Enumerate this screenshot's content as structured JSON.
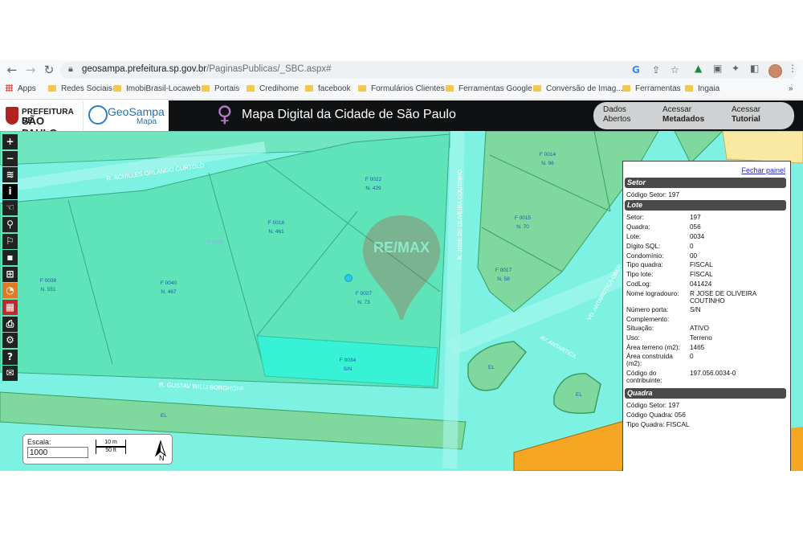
{
  "browser": {
    "url_host": "geosampa.prefeitura.sp.gov.br",
    "url_path": "/PaginasPublicas/_SBC.aspx#",
    "bookmarks": [
      "Apps",
      "Redes Sociais",
      "ImobiBrasil-Locaweb",
      "Portais",
      "Credihome",
      "facebook",
      "Formulários Clientes",
      "Ferramentas Google",
      "Conversão de Imag...",
      "Ferramentas",
      "Ingaia"
    ]
  },
  "header": {
    "pm_line1": "PREFEITURA DE",
    "pm_line2": "SÃO PAULO",
    "gs_title": "GeoSampa",
    "gs_sub": "Mapa",
    "app_title": "Mapa Digital da Cidade de São Paulo",
    "btn1_line1": "Dados",
    "btn1_line2": "Abertos",
    "btn2_line1": "Acessar",
    "btn2_line2": "Metadados",
    "btn3_line1": "Acessar",
    "btn3_line2": "Tutorial"
  },
  "map": {
    "streets": [
      "R. ACHILLES ORLANDO CURTOLO",
      "R. GUSTAV WILLI BORGHOFF",
      "R. JOSE DE OLIVEIRA COUTINHO",
      "AV. ANTARTICA",
      "VD. ANTARCTICA OBER..."
    ],
    "lots": [
      {
        "f": "F 0022",
        "n": "N. 429"
      },
      {
        "f": "F 0014",
        "n": "N. 96"
      },
      {
        "f": "F 0018",
        "n": "N. 461"
      },
      {
        "f": "F 0015",
        "n": "N. 70"
      },
      {
        "f": "F 0017",
        "n": "N. 58"
      },
      {
        "f": "F 0038",
        "n": "N. 551"
      },
      {
        "f": "F 0040",
        "n": "N. 467"
      },
      {
        "f": "F 0027",
        "n": "N. 73"
      },
      {
        "f": "F 0034",
        "n": "S/N"
      }
    ],
    "faint_lot": "F 0016",
    "el_labels": [
      "EL",
      "EL",
      "EL"
    ],
    "watermark": "RE/MAX"
  },
  "panel": {
    "close": "Fechar painel",
    "setor_title": "Setor",
    "setor_rows": [
      {
        "k": "Código Setor:",
        "v": "197"
      }
    ],
    "lote_title": "Lote",
    "lote_rows": [
      {
        "k": "Setor:",
        "v": "197"
      },
      {
        "k": "Quadra:",
        "v": "056"
      },
      {
        "k": "Lote:",
        "v": "0034"
      },
      {
        "k": "Dígito SQL:",
        "v": "0"
      },
      {
        "k": "Condomínio:",
        "v": "00"
      },
      {
        "k": "Tipo quadra:",
        "v": "FISCAL"
      },
      {
        "k": "Tipo lote:",
        "v": "FISCAL"
      },
      {
        "k": "CodLog:",
        "v": "041424"
      },
      {
        "k": "Nome logradouro:",
        "v": "R JOSE DE OLIVEIRA COUTINHO"
      },
      {
        "k": "Número porta:",
        "v": "S/N"
      },
      {
        "k": "Complemento:",
        "v": ""
      },
      {
        "k": "Situação:",
        "v": "ATIVO"
      },
      {
        "k": "Uso:",
        "v": "Terreno"
      },
      {
        "k": "Área terreno (m2):",
        "v": "1465"
      },
      {
        "k": "Área construída (m2):",
        "v": "0"
      },
      {
        "k": "Código do contribuinte:",
        "v": "197.056.0034-0"
      }
    ],
    "quadra_title": "Quadra",
    "quadra_rows": [
      {
        "k": "Código Setor:",
        "v": "197"
      },
      {
        "k": "Código Quadra:",
        "v": "056"
      },
      {
        "k": "Tipo Quadra:",
        "v": "FISCAL"
      }
    ]
  },
  "scale": {
    "label": "Escala:",
    "value": "1000",
    "bar_top": "10 m",
    "bar_bottom": "50 ft",
    "north": "N"
  },
  "tools": [
    "zoom-in",
    "zoom-out",
    "layers",
    "info",
    "hand",
    "search",
    "measure",
    "save",
    "ruler",
    "pizza",
    "grid",
    "print",
    "settings",
    "help",
    "mail"
  ],
  "colors": {
    "map_bg": "#7df2e2",
    "lot_fill": "#5fe3b8",
    "green": "#7fd99e",
    "orange": "#f5a623",
    "header": "#0f1113"
  }
}
